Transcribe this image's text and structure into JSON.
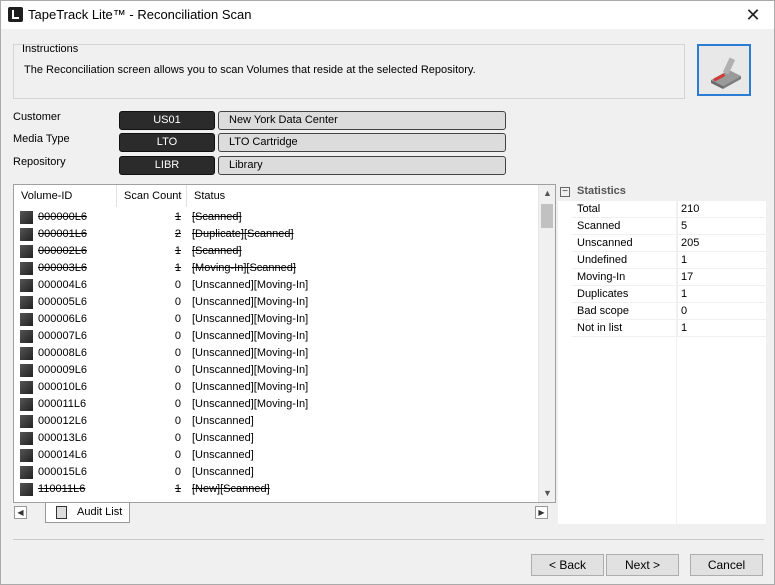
{
  "window": {
    "title": "TapeTrack Lite™ - Reconciliation Scan",
    "close_glyph": "✕"
  },
  "instructions": {
    "label": "Instructions",
    "text": "The Reconciliation screen allows you to scan Volumes that reside at the selected Repository."
  },
  "fields": {
    "customer": {
      "label": "Customer",
      "code": "US01",
      "name": "New York Data Center"
    },
    "media_type": {
      "label": "Media Type",
      "code": "LTO",
      "name": "LTO Cartridge"
    },
    "repository": {
      "label": "Repository",
      "code": "LIBR",
      "name": "Library"
    }
  },
  "list": {
    "columns": [
      "Volume-ID",
      "Scan Count",
      "Status"
    ],
    "rows": [
      {
        "id": "000000L6",
        "count": "1",
        "status": "[Scanned]",
        "struck": true
      },
      {
        "id": "000001L6",
        "count": "2",
        "status": "[Duplicate][Scanned]",
        "struck": true
      },
      {
        "id": "000002L6",
        "count": "1",
        "status": "[Scanned]",
        "struck": true
      },
      {
        "id": "000003L6",
        "count": "1",
        "status": "[Moving-In][Scanned]",
        "struck": true
      },
      {
        "id": "000004L6",
        "count": "0",
        "status": "[Unscanned][Moving-In]",
        "struck": false
      },
      {
        "id": "000005L6",
        "count": "0",
        "status": "[Unscanned][Moving-In]",
        "struck": false
      },
      {
        "id": "000006L6",
        "count": "0",
        "status": "[Unscanned][Moving-In]",
        "struck": false
      },
      {
        "id": "000007L6",
        "count": "0",
        "status": "[Unscanned][Moving-In]",
        "struck": false
      },
      {
        "id": "000008L6",
        "count": "0",
        "status": "[Unscanned][Moving-In]",
        "struck": false
      },
      {
        "id": "000009L6",
        "count": "0",
        "status": "[Unscanned][Moving-In]",
        "struck": false
      },
      {
        "id": "000010L6",
        "count": "0",
        "status": "[Unscanned][Moving-In]",
        "struck": false
      },
      {
        "id": "000011L6",
        "count": "0",
        "status": "[Unscanned][Moving-In]",
        "struck": false
      },
      {
        "id": "000012L6",
        "count": "0",
        "status": "[Unscanned]",
        "struck": false
      },
      {
        "id": "000013L6",
        "count": "0",
        "status": "[Unscanned]",
        "struck": false
      },
      {
        "id": "000014L6",
        "count": "0",
        "status": "[Unscanned]",
        "struck": false
      },
      {
        "id": "000015L6",
        "count": "0",
        "status": "[Unscanned]",
        "struck": false
      },
      {
        "id": "110011L6",
        "count": "1",
        "status": "[New][Scanned]",
        "struck": true
      }
    ],
    "scroll_up_glyph": "▲",
    "scroll_down_glyph": "▼"
  },
  "tabs": {
    "left_arrow": "◀",
    "right_arrow": "▶",
    "audit_label": "Audit List"
  },
  "statistics": {
    "title": "Statistics",
    "collapse_glyph": "−",
    "items": [
      {
        "label": "Total",
        "value": "210"
      },
      {
        "label": "Scanned",
        "value": "5"
      },
      {
        "label": "Unscanned",
        "value": "205"
      },
      {
        "label": "Undefined",
        "value": "1"
      },
      {
        "label": "Moving-In",
        "value": "17"
      },
      {
        "label": "Duplicates",
        "value": "1"
      },
      {
        "label": "Bad scope",
        "value": "0"
      },
      {
        "label": "Not in list",
        "value": "1"
      }
    ]
  },
  "buttons": {
    "back": "< Back",
    "next": "Next >",
    "cancel": "Cancel"
  },
  "colors": {
    "accent_border": "#2b7cd3",
    "code_box_bg": "#2b2b2b",
    "name_box_bg": "#dcdcdc"
  }
}
